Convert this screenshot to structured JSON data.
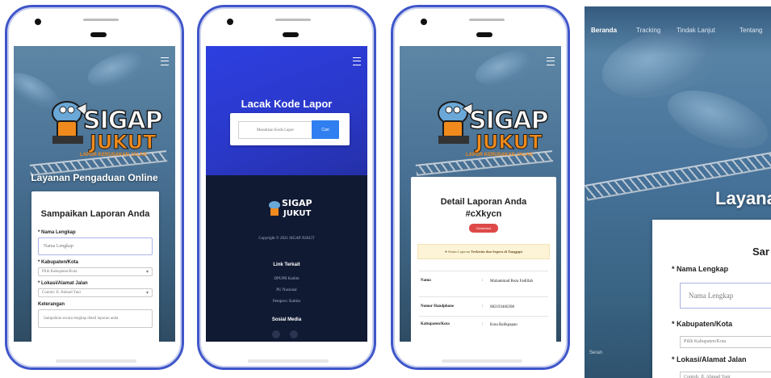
{
  "phone1": {
    "subtitle": "Layanan Pengaduan Online",
    "logo": {
      "line1": "SIGAP",
      "line2": "JUKUT",
      "tagline": "LAPOR KERUSAKAN JALAN"
    },
    "form": {
      "title": "Sampaikan Laporan Anda",
      "name_label": "* Nama Lengkap",
      "name_placeholder": "Nama Lengkap",
      "city_label": "* Kabupaten/Kota",
      "city_placeholder": "Pilih Kabupaten/Kota",
      "address_label": "* Lokasi/Alamat Jalan",
      "address_placeholder": "Contoh: Jl. Ahmad Yani",
      "desc_label": "Keterangan",
      "desc_placeholder": "Sampaikan secara lengkap detail laporan anda"
    }
  },
  "phone2": {
    "title": "Lacak Kode Lapor",
    "input_placeholder": "Masukkan Kode Lapor",
    "search_button": "Cari",
    "logo": {
      "line1": "SIGAP",
      "line2": "JUKUT"
    },
    "copyright": "Copyright © 2021 SIGAP JUKUT",
    "links_heading": "Link Terkait",
    "links": [
      "DPUPR Kaltim",
      "PU Nasional",
      "Pemprov. Kaltim"
    ],
    "social_heading": "Sosial Media"
  },
  "phone3": {
    "title_line1": "Detail Laporan Anda",
    "title_line2": "#cXkycn",
    "download_button": "Download",
    "alert_text_pre": "Status Laporan",
    "alert_text_strong": "Terkirim dan Segera di Tanggapi",
    "rows": [
      {
        "key": "Nama",
        "value": "Muhammad Reza Fadillah"
      },
      {
        "key": "Nomor Handphone",
        "value": "082193466398"
      },
      {
        "key": "Kabupaten/Kota",
        "value": "Kota Balikpapan"
      }
    ]
  },
  "desktop": {
    "nav": [
      "Beranda",
      "Tracking",
      "Tindak Lanjut",
      "Tentang"
    ],
    "subtitle_partial": "Layana",
    "card_title_partial": "Sar",
    "name_label": "* Nama Lengkap",
    "name_placeholder": "Nama Lengkap",
    "city_label": "* Kabupaten/Kota",
    "city_placeholder": "Pilih Kabupaten/Kota",
    "address_label": "* Lokasi/Alamat Jalan",
    "address_placeholder": "Contoh: Jl. Ahmad Yani",
    "map_label": "Seran"
  },
  "colors": {
    "frame": "#3f56c9",
    "brand_orange": "#f08a1c",
    "track_header": "#2d3fe0",
    "footer": "#111a33",
    "search_button": "#2f7ff0",
    "download_button": "#dd4a48"
  }
}
